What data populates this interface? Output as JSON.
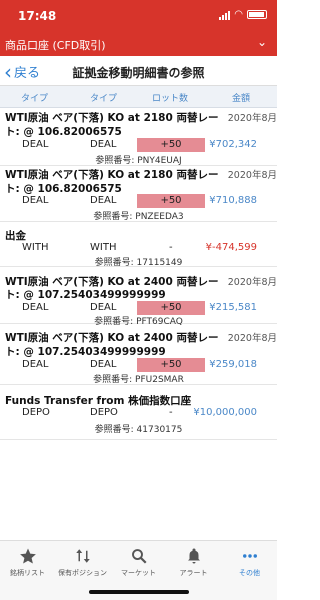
{
  "status_bar": {
    "time": "17:48"
  },
  "app_header": {
    "title": "商品口座 (CFD取引)",
    "chevron": "⌄"
  },
  "nav": {
    "back_label": "戻る",
    "back_icon": "‹",
    "title": "証拠金移動明細書の参照"
  },
  "columns": [
    "タイプ",
    "タイプ",
    "ロット数",
    "金額"
  ],
  "entries": [
    {
      "title_line1": "WTI原油 ベア(下落) KO at 2180 両替レー",
      "title_line2": "ト: @ 106.82006575",
      "date": "2020年8月",
      "type1": "DEAL",
      "type2": "DEAL",
      "lots": "+50",
      "amount": "¥702,342",
      "ref": "参照番号: PNY4EUAJ"
    },
    {
      "title_line1": "WTI原油 ベア(下落) KO at 2180 両替レー",
      "title_line2": "ト: @ 106.82006575",
      "date": "2020年8月",
      "type1": "DEAL",
      "type2": "DEAL",
      "lots": "+50",
      "amount": "¥710,888",
      "ref": "参照番号: PNZEEDA3"
    },
    {
      "title_line1": "出金",
      "type1": "WITH",
      "type2": "WITH",
      "lots": "-",
      "amount": "¥-474,599",
      "ref": "参照番号: 17115149"
    },
    {
      "title_line1": "WTI原油 ベア(下落) KO at 2400 両替レー",
      "title_line2": "ト: @ 107.25403499999999",
      "date": "2020年8月",
      "type1": "DEAL",
      "type2": "DEAL",
      "lots": "+50",
      "amount": "¥215,581",
      "ref": "参照番号: PFT69CAQ"
    },
    {
      "title_line1": "WTI原油 ベア(下落) KO at 2400 両替レー",
      "title_line2": "ト: @ 107.25403499999999",
      "date": "2020年8月",
      "type1": "DEAL",
      "type2": "DEAL",
      "lots": "+50",
      "amount": "¥259,018",
      "ref": "参照番号: PFU2SMAR"
    },
    {
      "title_line1": "Funds Transfer from 株価指数口座",
      "type1": "DEPO",
      "type2": "DEPO",
      "lots": "-",
      "amount": "¥10,000,000",
      "ref": "参照番号: 41730175"
    }
  ],
  "tabs": [
    {
      "label": "銘柄リスト",
      "icon": "star-icon"
    },
    {
      "label": "保有ポジション",
      "icon": "arrows-icon"
    },
    {
      "label": "マーケット",
      "icon": "search-icon"
    },
    {
      "label": "アラート",
      "icon": "bell-icon"
    },
    {
      "label": "その他",
      "icon": "more-icon",
      "active": true
    }
  ],
  "colors": {
    "brand_red": "#d7342b",
    "link_blue": "#2f7fd0",
    "amount_blue": "#4b88c8",
    "lots_highlight": "#e58c94"
  }
}
